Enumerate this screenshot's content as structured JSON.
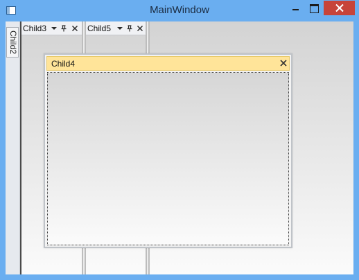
{
  "window": {
    "title": "MainWindow",
    "accent_color": "#6aaef0",
    "close_button_color": "#c7443a",
    "icons": {
      "app": "window-app-icon",
      "minimize": "minimize-icon",
      "maximize": "maximize-icon",
      "close": "close-icon"
    }
  },
  "sidebar": {
    "tabs": [
      {
        "label": "Child2"
      }
    ]
  },
  "docked_panes": [
    {
      "title": "Child3",
      "icons": [
        "dropdown-icon",
        "pin-icon",
        "close-icon"
      ]
    },
    {
      "title": "Child5",
      "icons": [
        "dropdown-icon",
        "pin-icon",
        "close-icon"
      ]
    }
  ],
  "floating_window": {
    "title": "Child4",
    "header_color": "#ffe499",
    "icons": [
      "close-icon"
    ]
  }
}
